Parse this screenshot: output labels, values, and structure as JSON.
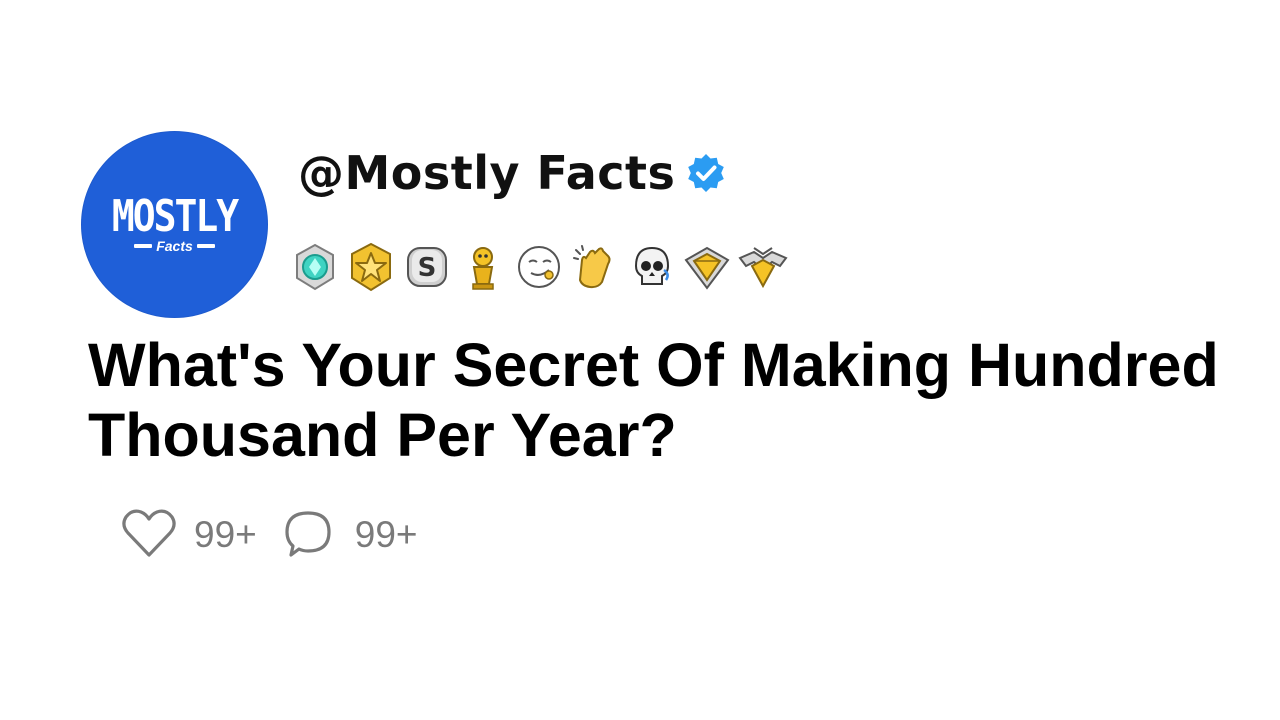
{
  "avatar": {
    "line1": "MOSTLY",
    "line2": "Facts",
    "color": "#1f5fd8"
  },
  "profile": {
    "handle": "@Mostly Facts",
    "verified_color": "#2b9cf2"
  },
  "badges": [
    {
      "icon": "diamond-medal-icon"
    },
    {
      "icon": "star-badge-icon"
    },
    {
      "icon": "silver-s-coin-icon"
    },
    {
      "icon": "gold-trophy-icon"
    },
    {
      "icon": "smirk-face-icon"
    },
    {
      "icon": "clapping-hands-icon"
    },
    {
      "icon": "skull-icon"
    },
    {
      "icon": "gold-gem-icon"
    },
    {
      "icon": "winged-heart-icon"
    }
  ],
  "post": {
    "title": "What's Your Secret Of Making Hundred Thousand Per Year?"
  },
  "stats": {
    "likes": "99+",
    "comments": "99+"
  }
}
